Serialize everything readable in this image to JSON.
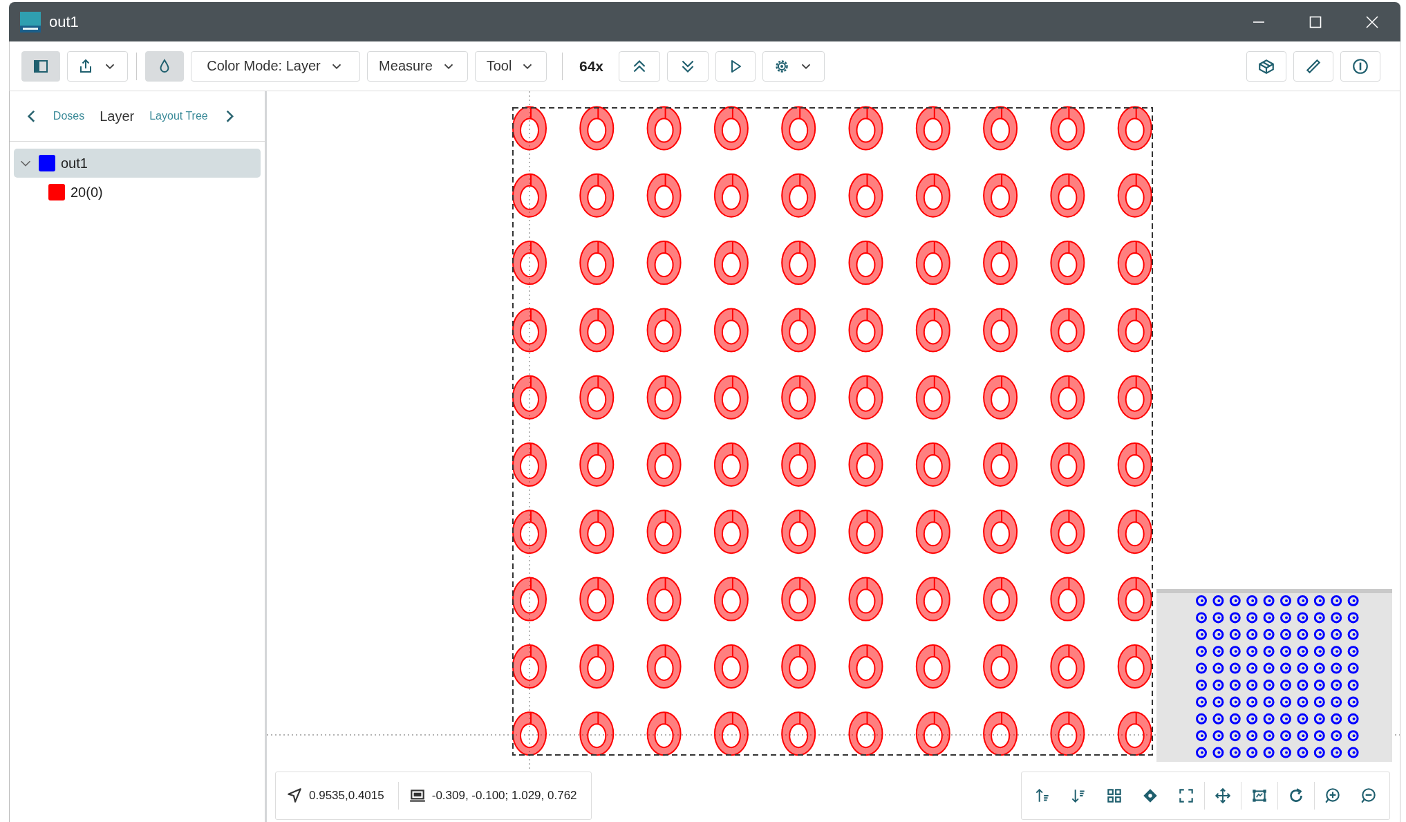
{
  "window": {
    "title": "out1"
  },
  "toolbar": {
    "sidebar_toggle_active": true,
    "color_picker_active": true,
    "color_mode": "Color Mode: Layer",
    "measure": "Measure",
    "tool": "Tool",
    "zoom": "64x"
  },
  "tabs": [
    {
      "label": "Doses",
      "selected": false
    },
    {
      "label": "Layer",
      "selected": true
    },
    {
      "label": "Layout Tree",
      "selected": false
    }
  ],
  "tree": [
    {
      "label": "out1",
      "color": "#0000ff",
      "selected": true,
      "expanded": true,
      "children": [
        {
          "label": "20(0)",
          "color": "#ff0000",
          "selected": false
        }
      ]
    }
  ],
  "status_bar": {
    "cursor": "0.9535,0.4015",
    "bounds": "-0.309, -0.100; 1.029, 0.762"
  }
}
